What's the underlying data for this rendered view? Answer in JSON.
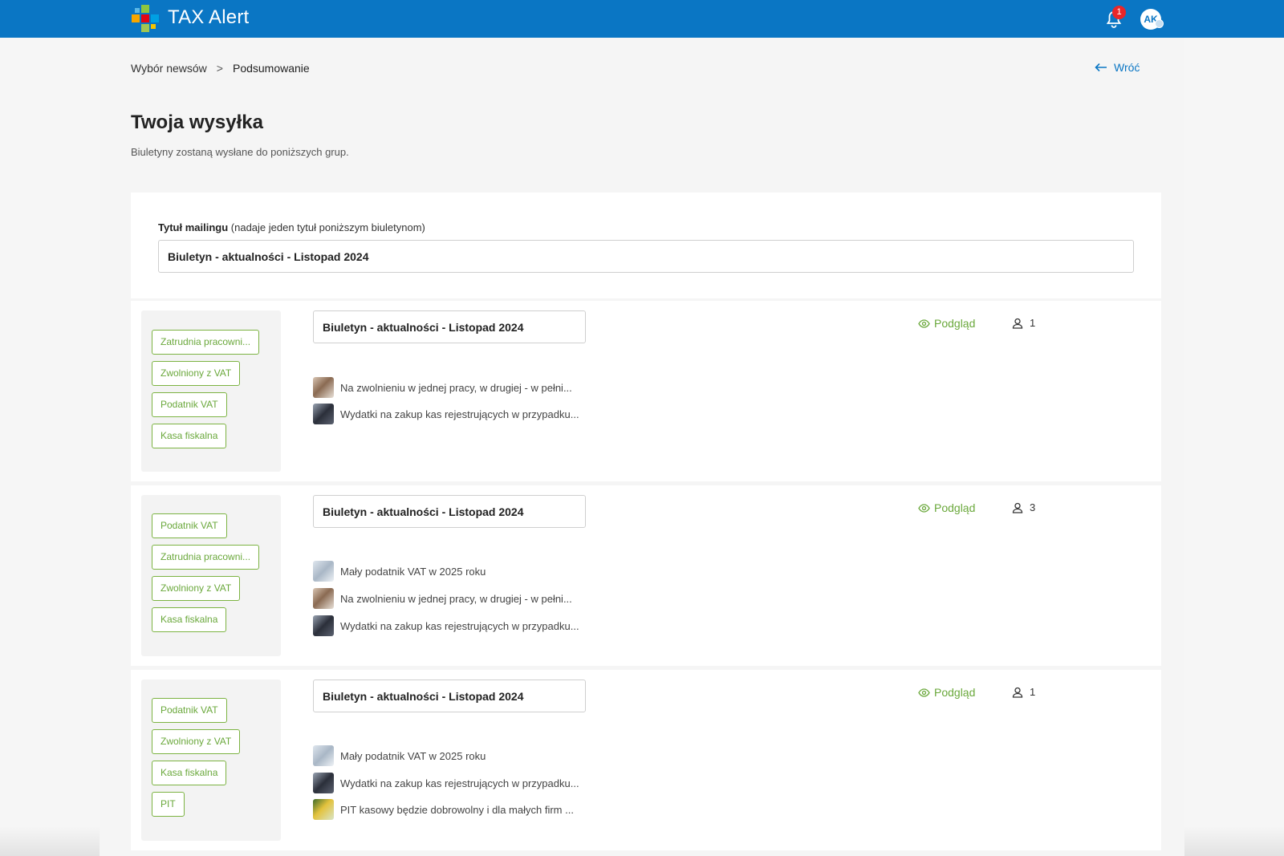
{
  "app": {
    "title": "TAX Alert",
    "notification_count": "1",
    "avatar_initials": "AK"
  },
  "breadcrumb": {
    "step1": "Wybór newsów",
    "separator": ">",
    "step2": "Podsumowanie"
  },
  "back_label": "Wróć",
  "page": {
    "title": "Twoja wysyłka",
    "subtitle": "Biuletyny zostaną wysłane do poniższych grup."
  },
  "mailing": {
    "label_bold": "Tytuł mailingu",
    "label_hint": "(nadaje jeden tytuł poniższym biuletynom)",
    "value": "Biuletyn - aktualności - Listopad 2024"
  },
  "preview_label": "Podgląd",
  "bulletins": [
    {
      "title": "Biuletyn - aktualności - Listopad 2024",
      "recipients": "1",
      "tags": [
        "Zatrudnia pracowni...",
        "Zwolniony z VAT",
        "Podatnik VAT",
        "Kasa fiskalna"
      ],
      "news": [
        {
          "title": "Na zwolnieniu w jednej pracy, w drugiej - w pełni...",
          "thumb": "photo-person"
        },
        {
          "title": "Wydatki na zakup kas rejestrujących w przypadku...",
          "thumb": "photo-cash-register"
        }
      ]
    },
    {
      "title": "Biuletyn - aktualności - Listopad 2024",
      "recipients": "3",
      "tags": [
        "Podatnik VAT",
        "Zatrudnia pracowni...",
        "Zwolniony z VAT",
        "Kasa fiskalna"
      ],
      "news": [
        {
          "title": "Mały podatnik VAT w 2025 roku",
          "thumb": "photo-documents"
        },
        {
          "title": "Na zwolnieniu w jednej pracy, w drugiej - w pełni...",
          "thumb": "photo-person"
        },
        {
          "title": "Wydatki na zakup kas rejestrujących w przypadku...",
          "thumb": "photo-cash-register"
        }
      ]
    },
    {
      "title": "Biuletyn - aktualności - Listopad 2024",
      "recipients": "1",
      "tags": [
        "Podatnik VAT",
        "Zwolniony z VAT",
        "Kasa fiskalna",
        "PIT"
      ],
      "news": [
        {
          "title": "Mały podatnik VAT w 2025 roku",
          "thumb": "photo-documents"
        },
        {
          "title": "Wydatki na zakup kas rejestrujących w przypadku...",
          "thumb": "photo-cash-register"
        },
        {
          "title": "PIT kasowy będzie dobrowolny i dla małych firm ...",
          "thumb": "photo-coins"
        }
      ]
    }
  ],
  "colors": {
    "brand": "#0a76c4",
    "accent_green": "#6aa83b",
    "badge": "#e8262a"
  }
}
